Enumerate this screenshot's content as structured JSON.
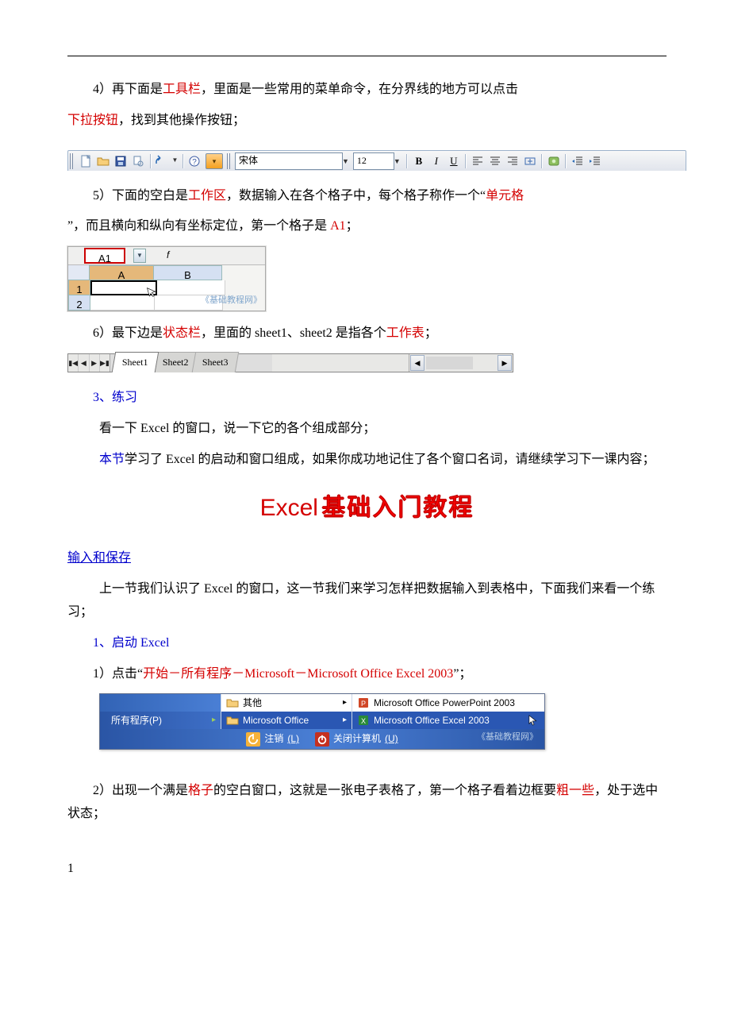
{
  "paragraphs": {
    "p4a": "4）再下面是",
    "p4_term": "工具栏",
    "p4b": "，里面是一些常用的菜单命令，在分界线的地方可以点击",
    "p4_term2": "下拉按钮",
    "p4c": "，找到其他操作按钮；",
    "p5a": "5）下面的空白是",
    "p5_term": "工作区",
    "p5b": "，数据输入在各个格子中，每个格子称作一个“",
    "p5_term2": "单元格",
    "p5c": "”，而且横向和纵向有坐标定位，第一个格子是 ",
    "p5_term3": "A1",
    "p5d": "；",
    "p6a": "6）最下边是",
    "p6_term": "状态栏",
    "p6b": "，里面的 sheet1、sheet2 是指各个",
    "p6_term2": "工作表",
    "p6c": "；",
    "sec3": "3、练习",
    "sec3_body": "看一下 Excel 的窗口，说一下它的各个组成部分；",
    "summary_a": "本节",
    "summary_b": "学习了 Excel 的启动和窗口组成，如果你成功地记住了各个窗口名词，请继续学习下一课内容；",
    "title_a": "Excel",
    "title_b": "基础入门教程",
    "input_save": "输入和保存",
    "intro2": "上一节我们认识了 Excel 的窗口，这一节我们来学习怎样把数据输入到表格中，下面我们来看一个练习；",
    "sec1": "1、启动 Excel",
    "p1a": "1）点击“",
    "p1_term": "开始－所有程序－Microsoft－Microsoft Office Excel 2003",
    "p1b": "”；",
    "p2a": "2）出现一个满是",
    "p2_term": "格子",
    "p2b": "的空白窗口，这就是一张电子表格了，第一个格子看着边框要",
    "p2_term2": "粗一些",
    "p2c": "，处于选中状态；",
    "page_number": "1"
  },
  "toolbar": {
    "font_name": "宋体",
    "font_size": "12",
    "bold": "B",
    "italic": "I",
    "underline": "U"
  },
  "gridfig": {
    "namebox": "A1",
    "colA": "A",
    "colB": "B",
    "row1": "1",
    "row2": "2",
    "watermark": "《基础教程网》"
  },
  "sheetbar": {
    "s1": "Sheet1",
    "s2": "Sheet2",
    "s3": "Sheet3"
  },
  "startmenu": {
    "all_programs": "所有程序",
    "all_programs_u": "(P)",
    "other": "其他",
    "ms_office": "Microsoft Office",
    "ppt": "Microsoft Office PowerPoint 2003",
    "excel": "Microsoft Office Excel 2003",
    "logoff": "注销",
    "logoff_u": "(L)",
    "shutdown": "关闭计算机",
    "shutdown_u": "(U)",
    "watermark": "《基础教程网》"
  }
}
